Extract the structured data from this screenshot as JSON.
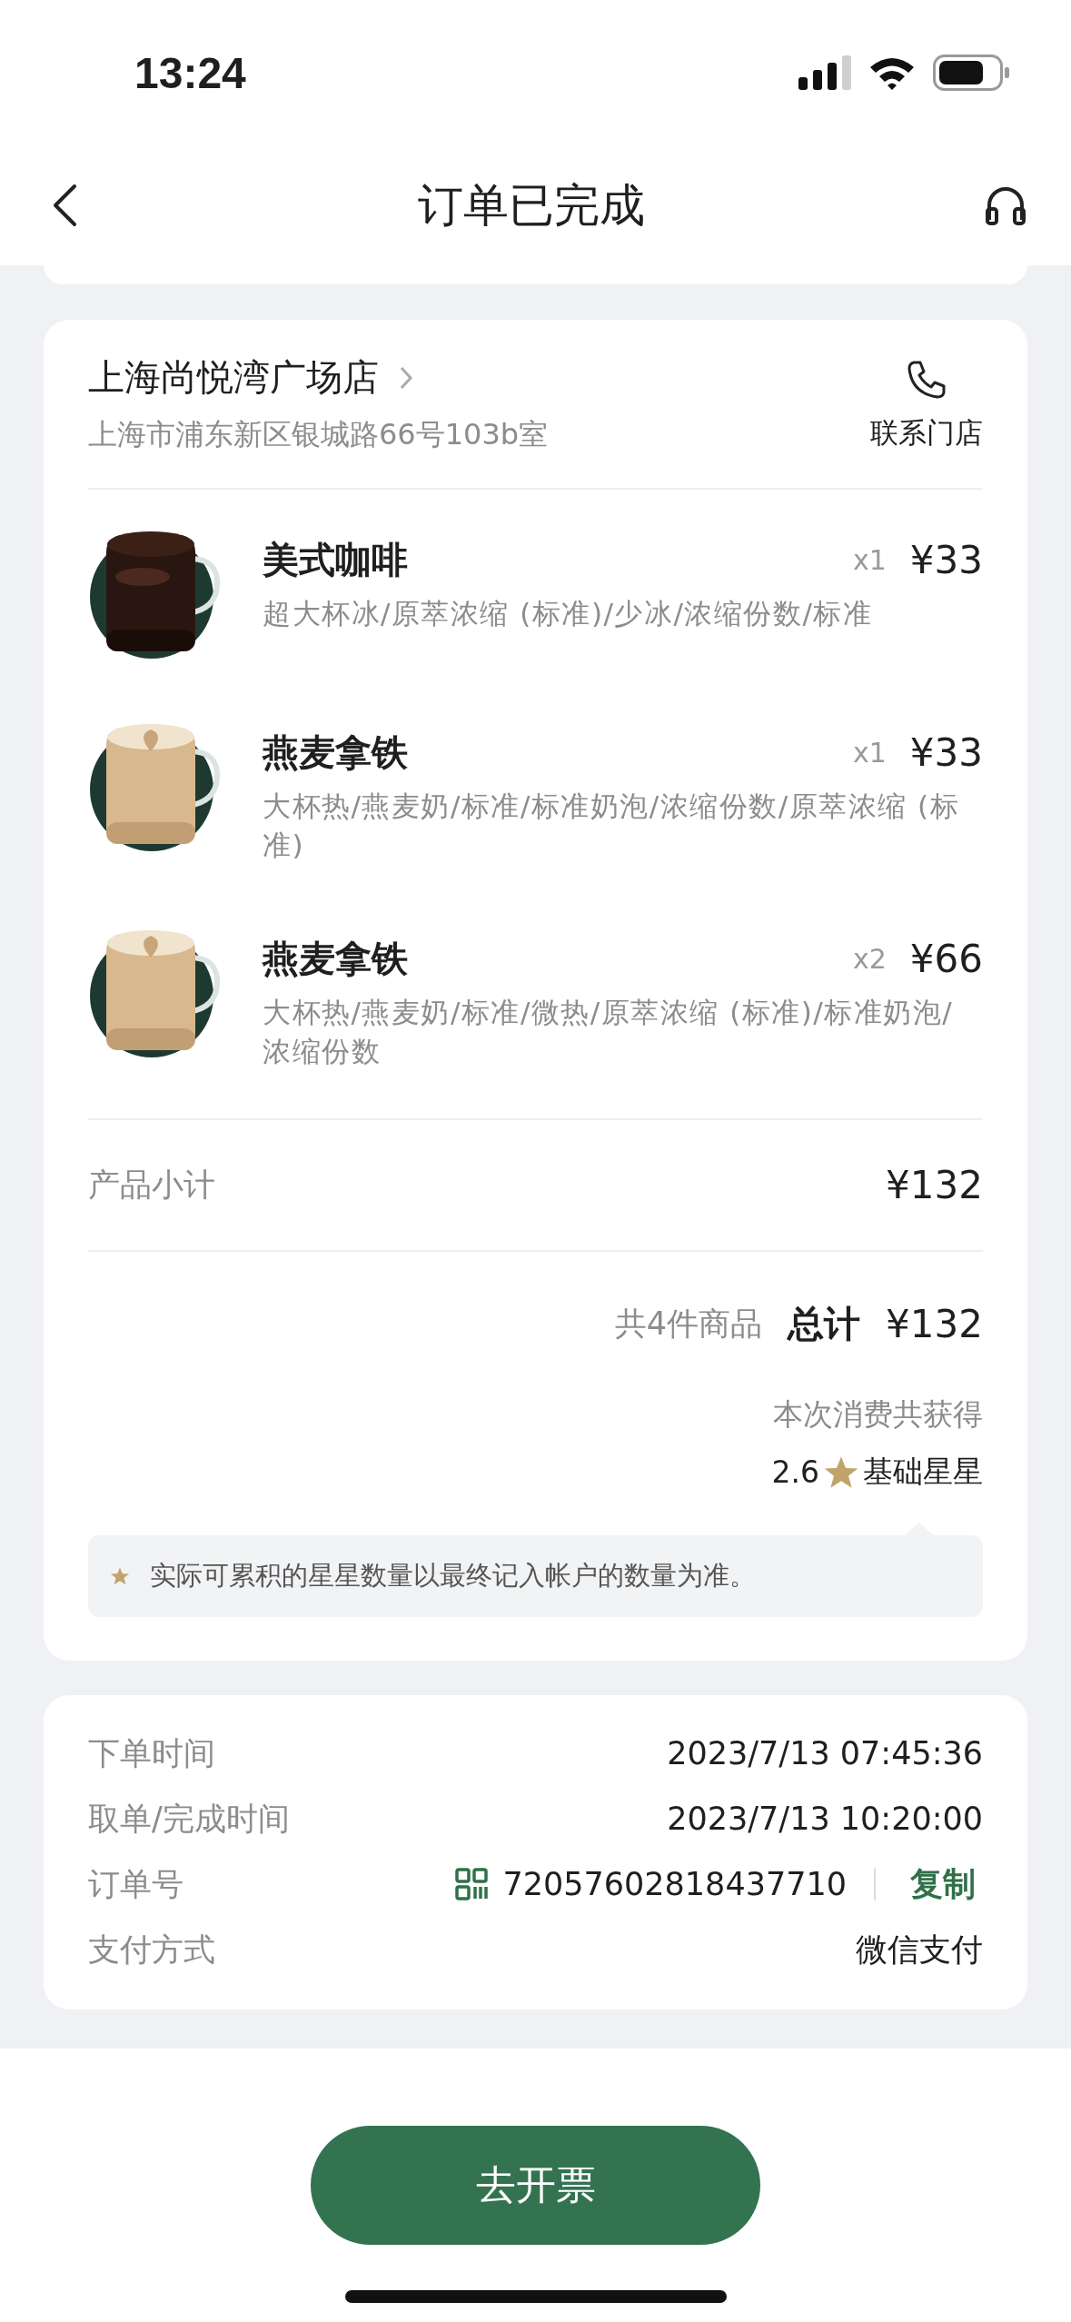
{
  "status_bar": {
    "time": "13:24"
  },
  "nav": {
    "title": "订单已完成"
  },
  "store": {
    "name": "上海尚悦湾广场店",
    "address": "上海市浦东新区银城路66号103b室",
    "contact_label": "联系门店"
  },
  "items": [
    {
      "kind": "black",
      "name": "美式咖啡",
      "qty": "x1",
      "price": "¥33",
      "options": "超大杯冰/原萃浓缩 (标准)/少冰/浓缩份数/标准"
    },
    {
      "kind": "latte",
      "name": "燕麦拿铁",
      "qty": "x1",
      "price": "¥33",
      "options": "大杯热/燕麦奶/标准/标准奶泡/浓缩份数/原萃浓缩 (标准)"
    },
    {
      "kind": "latte",
      "name": "燕麦拿铁",
      "qty": "x2",
      "price": "¥66",
      "options": "大杯热/燕麦奶/标准/微热/原萃浓缩 (标准)/标准奶泡/浓缩份数"
    }
  ],
  "subtotal": {
    "label": "产品小计",
    "value": "¥132"
  },
  "total": {
    "count_label": "共4件商品",
    "label": "总计",
    "value": "¥132"
  },
  "stars": {
    "label": "本次消费共获得",
    "value": "2.6",
    "unit": "基础星星"
  },
  "note": "实际可累积的星星数量以最终记入帐户的数量为准。",
  "order_info": [
    {
      "kind": "text",
      "label": "下单时间",
      "value": "2023/7/13 07:45:36"
    },
    {
      "kind": "text",
      "label": "取单/完成时间",
      "value": "2023/7/13 10:20:00"
    },
    {
      "kind": "order_no",
      "label": "订单号",
      "value": "72057602818437710",
      "action": "复制"
    },
    {
      "kind": "text",
      "label": "支付方式",
      "value": "微信支付"
    }
  ],
  "primary_button": "去开票"
}
